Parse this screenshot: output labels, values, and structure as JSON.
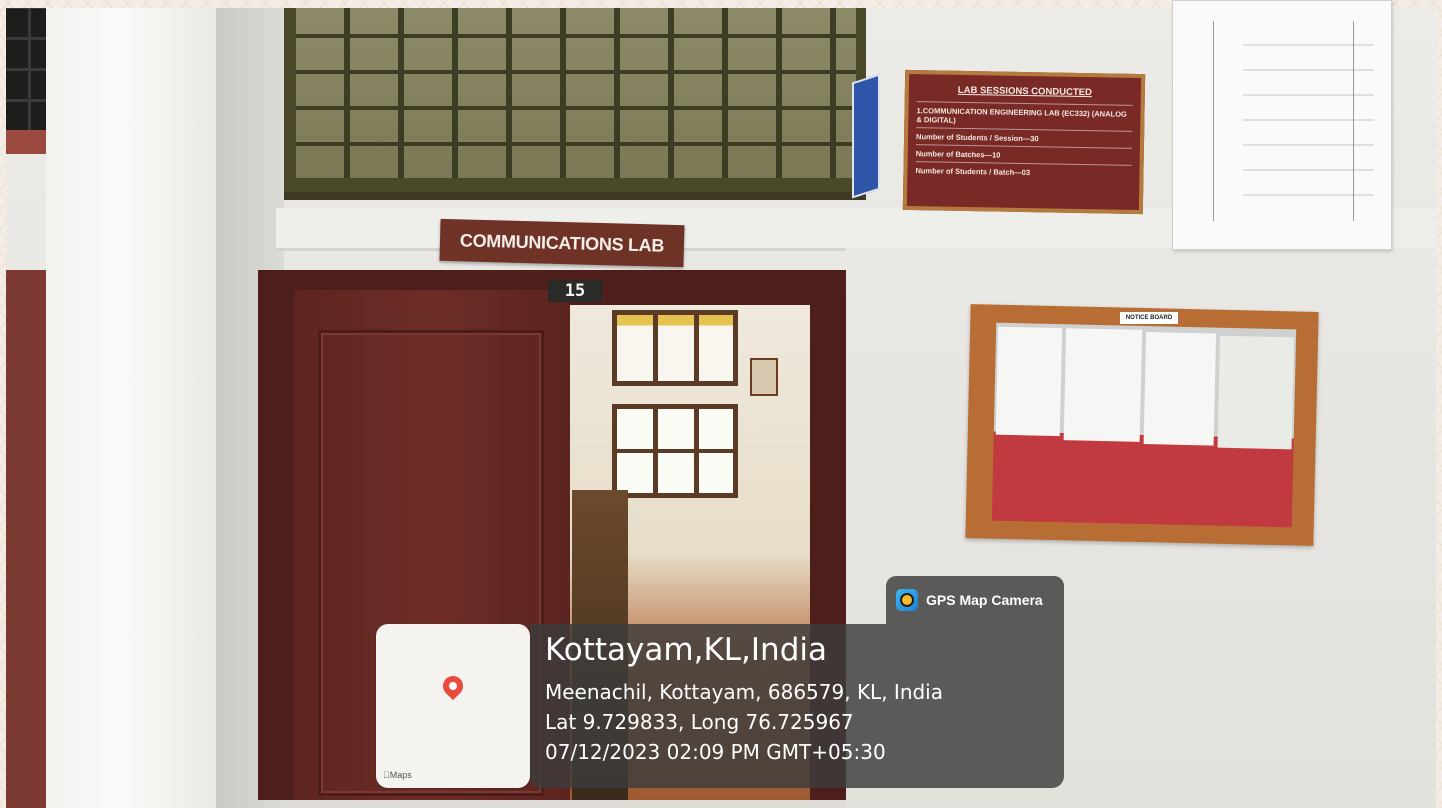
{
  "scene": {
    "lab_sign": "COMMUNICATIONS LAB",
    "door_number": "15",
    "placard": {
      "title": "LAB SESSIONS CONDUCTED",
      "lines": [
        "1.COMMUNICATION ENGINEERING LAB (EC332) (ANALOG & DIGITAL)",
        "Number of Students / Session—30",
        "Number of Batches—10",
        "Number of Students / Batch—03"
      ]
    },
    "notice_board_label": "NOTICE BOARD"
  },
  "gps_overlay": {
    "app_name": "GPS Map Camera",
    "location_title": "Kottayam,KL,India",
    "address": "Meenachil, Kottayam, 686579, KL, India",
    "coordinates": "Lat 9.729833, Long 76.725967",
    "datetime": "07/12/2023 02:09 PM GMT+05:30",
    "map_label": "Maps"
  }
}
